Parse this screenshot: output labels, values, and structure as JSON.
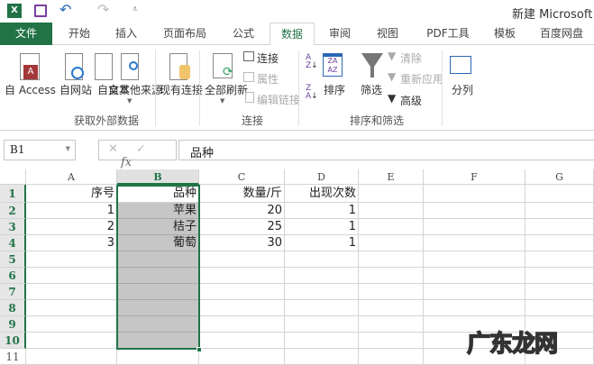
{
  "title": "新建 Microsoft",
  "tabs": [
    "文件",
    "开始",
    "插入",
    "页面布局",
    "公式",
    "数据",
    "审阅",
    "视图",
    "PDF工具",
    "模板",
    "百度网盘"
  ],
  "active_tab": "数据",
  "ribbon": {
    "get_external": {
      "access": "自 Access",
      "web": "自网站",
      "text": "自文本",
      "other": "自其他来源",
      "existing": "现有连接",
      "label": "获取外部数据"
    },
    "connections": {
      "refresh_all": "全部刷新",
      "connections": "连接",
      "properties": "属性",
      "edit_links": "编辑链接",
      "label": "连接"
    },
    "sort_filter": {
      "sort": "排序",
      "filter": "筛选",
      "clear": "清除",
      "reapply": "重新应用",
      "advanced": "高级",
      "label": "排序和筛选"
    },
    "text_to_columns": "分列"
  },
  "formula_bar": {
    "name_box": "B1",
    "fx": "fx",
    "value": "品种"
  },
  "columns": [
    "A",
    "B",
    "C",
    "D",
    "E",
    "F",
    "G"
  ],
  "rows": [
    "1",
    "2",
    "3",
    "4",
    "5",
    "6",
    "7",
    "8",
    "9",
    "10",
    "11"
  ],
  "cells": [
    [
      "序号",
      "品种",
      "数量/斤",
      "出现次数"
    ],
    [
      "1",
      "苹果",
      "20",
      "1"
    ],
    [
      "2",
      "桔子",
      "25",
      "1"
    ],
    [
      "3",
      "葡萄",
      "30",
      "1"
    ]
  ],
  "watermark": "广东龙网"
}
